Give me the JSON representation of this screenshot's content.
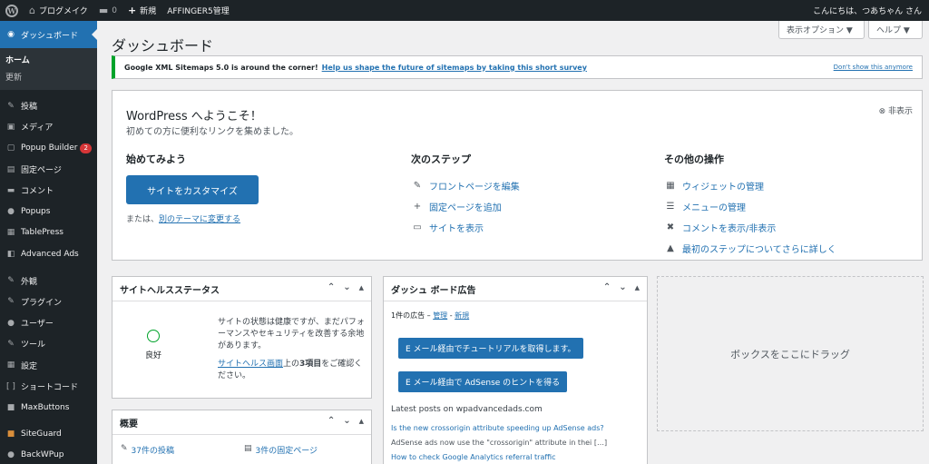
{
  "adminbar": {
    "site_name": "ブログメイク",
    "comments_count": "0",
    "new_label": "新規",
    "affinger_label": "AFFINGER5管理",
    "greeting": "こんにちは、つあちゃん さん"
  },
  "sidebar": {
    "dashboard_label": "ダッシュボード",
    "submenu": [
      "ホーム",
      "更新"
    ],
    "items": [
      {
        "label": "投稿",
        "icon": "✎"
      },
      {
        "label": "メディア",
        "icon": "▣"
      },
      {
        "label": "Popup Builder",
        "icon": "▢",
        "badge": "2"
      },
      {
        "label": "固定ページ",
        "icon": "▤"
      },
      {
        "label": "コメント",
        "icon": "▬"
      },
      {
        "label": "Popups",
        "icon": "●"
      },
      {
        "label": "TablePress",
        "icon": "▦"
      },
      {
        "label": "Advanced Ads",
        "icon": "◧"
      },
      {
        "label": "外観",
        "icon": "✎"
      },
      {
        "label": "プラグイン",
        "icon": "✎"
      },
      {
        "label": "ユーザー",
        "icon": "●"
      },
      {
        "label": "ツール",
        "icon": "✎"
      },
      {
        "label": "設定",
        "icon": "▦"
      },
      {
        "label": "ショートコード",
        "icon": "[ ]"
      },
      {
        "label": "MaxButtons",
        "icon": "■"
      },
      {
        "label": "SiteGuard",
        "icon": "■"
      },
      {
        "label": "BackWPup",
        "icon": "●"
      }
    ]
  },
  "header": {
    "title": "ダッシュボード",
    "screen_options": "表示オプション ▼",
    "help": "ヘルプ ▼"
  },
  "notice": {
    "text": "Google XML Sitemaps 5.0 is around the corner!",
    "link": "Help us shape the future of sitemaps by taking this short survey",
    "dismiss": "Don't show this anymore"
  },
  "welcome": {
    "title": "WordPress へようこそ！",
    "subtitle": "初めての方に便利なリンクを集めました。",
    "hide": "非表示",
    "col1": {
      "heading": "始めてみよう",
      "button": "サイトをカスタマイズ",
      "or_text": "または、",
      "theme_link": "別のテーマに変更する"
    },
    "col2": {
      "heading": "次のステップ",
      "links": [
        "フロントページを編集",
        "固定ページを追加",
        "サイトを表示"
      ]
    },
    "col3": {
      "heading": "その他の操作",
      "links": [
        "ウィジェットの管理",
        "メニューの管理",
        "コメントを表示/非表示",
        "最初のステップについてさらに詳しく"
      ]
    }
  },
  "site_health": {
    "title": "サイトヘルスステータス",
    "status": "良好",
    "description": "サイトの状態は健康ですが、まだパフォーマンスやセキュリティを改善する余地があります。",
    "link": "サイトヘルス画面",
    "link_suffix": "上の",
    "count": "3項目",
    "suffix": "をご確認ください。"
  },
  "ads_box": {
    "title": "ダッシュ ボード広告",
    "count_text": "1件の広告 –",
    "manage": "管理",
    "sep": "-",
    "new": "新規",
    "btn1": "E メール経由でチュートリアルを取得します。",
    "btn2": "E メール経由で AdSense のヒントを得る",
    "latest": "Latest posts on wpadvancedads.com",
    "post1": "Is the new crossorigin attribute speeding up AdSense ads?",
    "post1_excerpt": "AdSense ads now use the \"crossorigin\" attribute in thei […]",
    "post2": "How to check Google Analytics referral traffic"
  },
  "overview": {
    "title": "概要",
    "posts": "37件の投稿",
    "pages": "3件の固定ページ"
  },
  "drop_zone": "ボックスをここにドラッグ"
}
